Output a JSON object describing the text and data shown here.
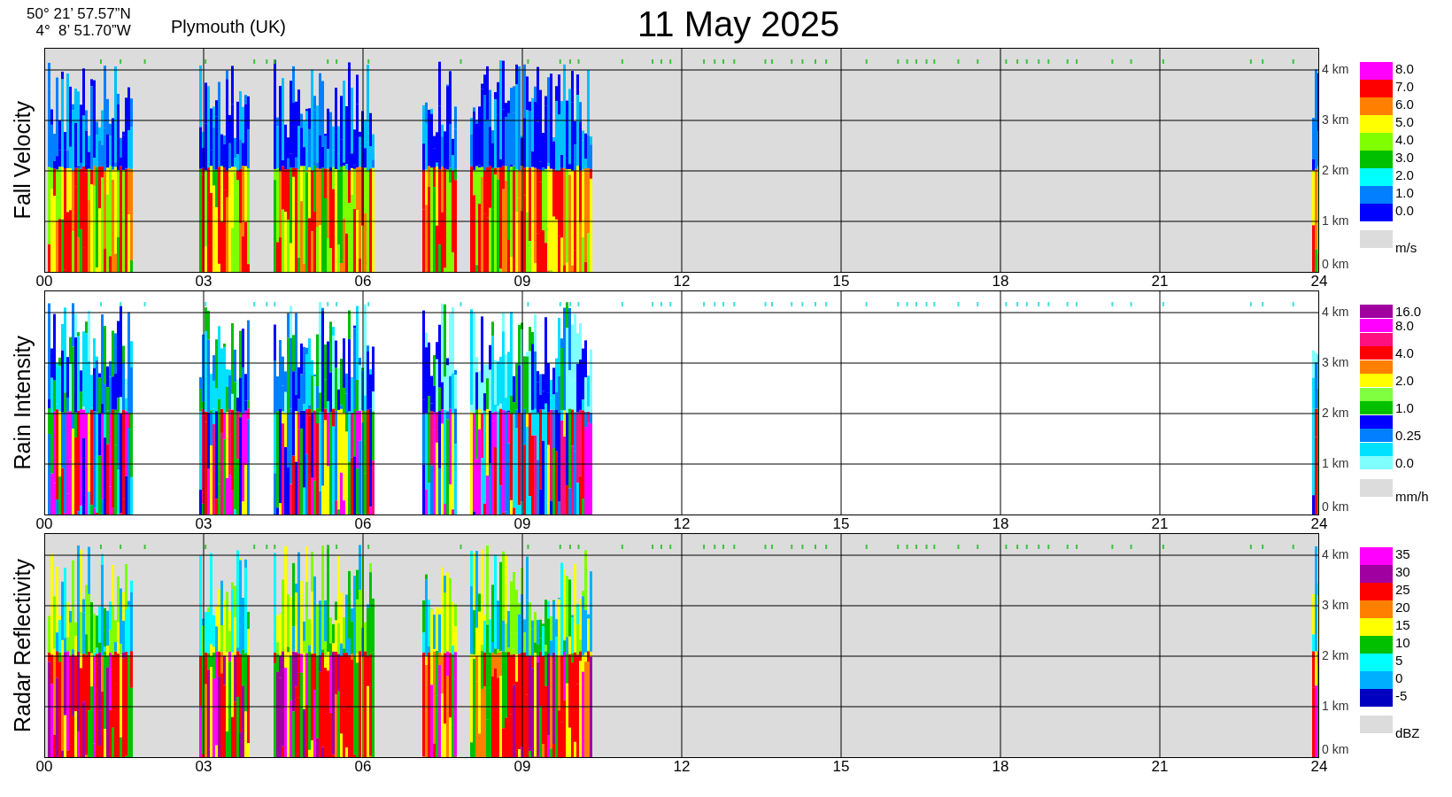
{
  "header": {
    "latitude": "50° 21’ 57.57”N",
    "longitude": "4°  8’ 51.70”W",
    "location": "Plymouth (UK)",
    "date": "11 May 2025"
  },
  "panels": [
    {
      "kind": "velocity",
      "title": "Fall Velocity",
      "x_labels": [
        "00",
        "03",
        "06",
        "09",
        "12",
        "15",
        "18",
        "21",
        "24"
      ],
      "y_labels": [
        "4 km",
        "3 km",
        "2 km",
        "1 km",
        "0 km"
      ],
      "legend": {
        "bands": [
          {
            "color": "#ff00ff",
            "label": "8.0"
          },
          {
            "color": "#ff0000",
            "label": "7.0"
          },
          {
            "color": "#ff8000",
            "label": "6.0"
          },
          {
            "color": "#ffff00",
            "label": "5.0"
          },
          {
            "color": "#80ff00",
            "label": "4.0"
          },
          {
            "color": "#00c000",
            "label": "3.0"
          },
          {
            "color": "#00ffff",
            "label": "2.0"
          },
          {
            "color": "#0080ff",
            "label": "1.0"
          },
          {
            "color": "#0000ff",
            "label": "0.0"
          }
        ],
        "unit": "m/s"
      }
    },
    {
      "kind": "rain",
      "title": "Rain Intensity",
      "x_labels": [
        "00",
        "03",
        "06",
        "09",
        "12",
        "15",
        "18",
        "21",
        "24"
      ],
      "y_labels": [
        "4 km",
        "3 km",
        "2 km",
        "1 km",
        "0 km"
      ],
      "legend": {
        "bands": [
          {
            "color": "#a000a0",
            "label": "16.0"
          },
          {
            "color": "#ff00ff",
            "label": "8.0"
          },
          {
            "color": "#ff1080"
          },
          {
            "color": "#ff0000",
            "label": "4.0"
          },
          {
            "color": "#ff8000"
          },
          {
            "color": "#ffff00",
            "label": "2.0"
          },
          {
            "color": "#80ff40"
          },
          {
            "color": "#00c000",
            "label": "1.0"
          },
          {
            "color": "#0000ff"
          },
          {
            "color": "#0080ff",
            "label": "0.25"
          },
          {
            "color": "#00e0ff"
          },
          {
            "color": "#80ffff",
            "label": "0.0"
          }
        ],
        "unit": "mm/h"
      }
    },
    {
      "kind": "reflectivity",
      "title": "Radar Reflectivity",
      "x_labels": [
        "00",
        "03",
        "06",
        "09",
        "12",
        "15",
        "18",
        "21",
        "24"
      ],
      "y_labels": [
        "4 km",
        "3 km",
        "2 km",
        "1 km",
        "0 km"
      ],
      "legend": {
        "bands": [
          {
            "color": "#ff00ff",
            "label": "35"
          },
          {
            "color": "#a000a0",
            "label": "30"
          },
          {
            "color": "#ff0000",
            "label": "25"
          },
          {
            "color": "#ff8000",
            "label": "20"
          },
          {
            "color": "#ffff00",
            "label": "15"
          },
          {
            "color": "#00c000",
            "label": "10"
          },
          {
            "color": "#00ffff",
            "label": "5"
          },
          {
            "color": "#00b0ff",
            "label": "0"
          },
          {
            "color": "#0000c0",
            "label": "-5"
          }
        ],
        "unit": "dBZ"
      }
    }
  ]
}
